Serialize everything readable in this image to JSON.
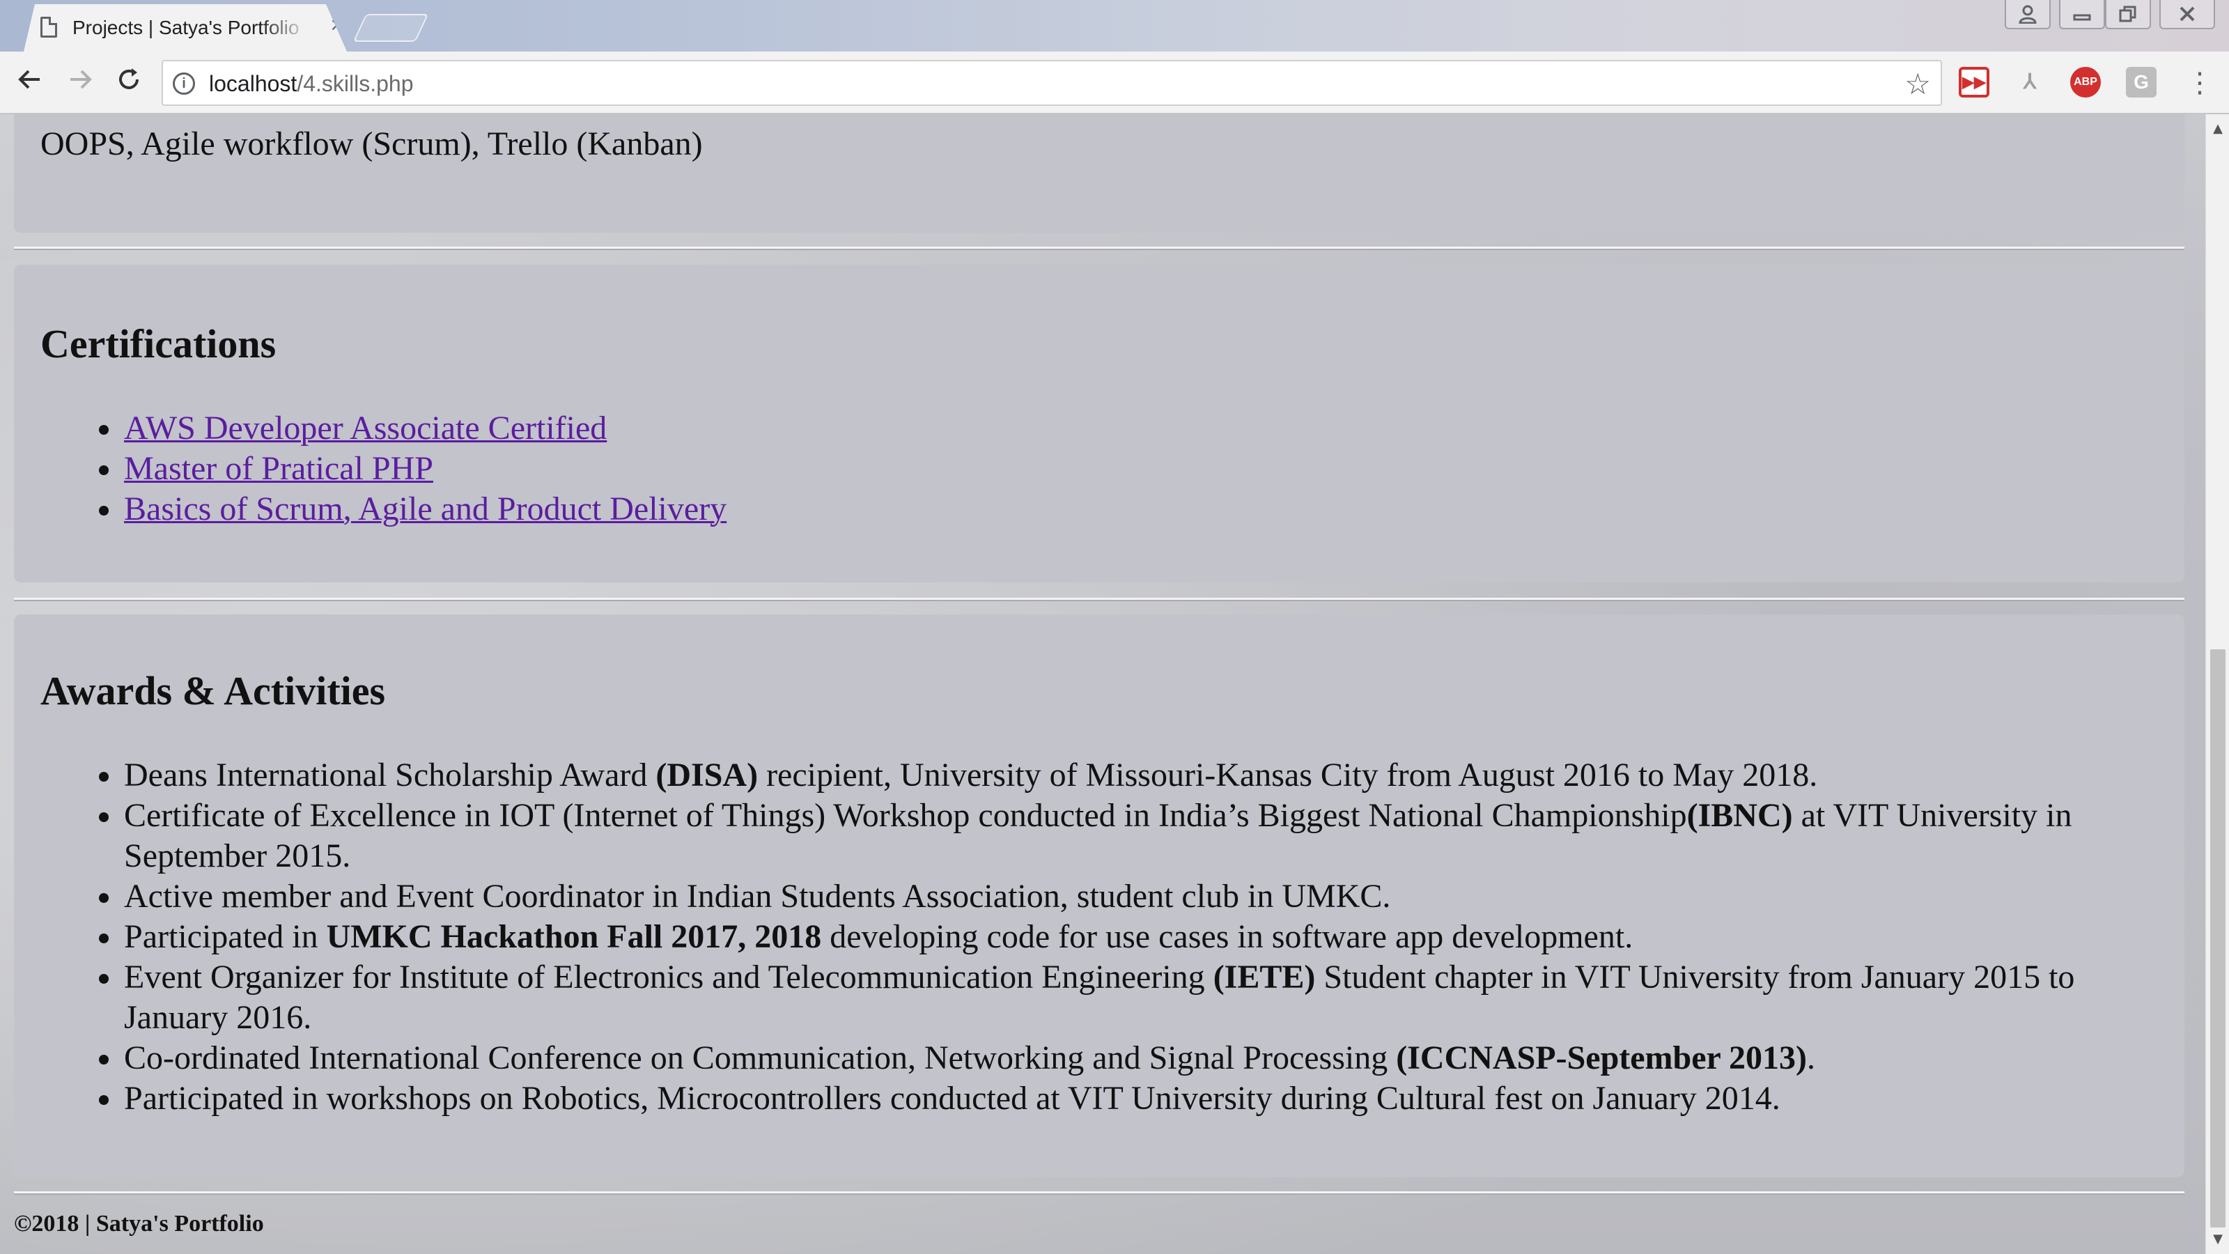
{
  "browser": {
    "tab_title": "Projects | Satya's Portfolio",
    "tab_close": "×",
    "url_host": "localhost",
    "url_path": "/4.skills.php",
    "info_symbol": "i",
    "ext_pdf": "⅄",
    "ext_abp": "ABP",
    "ext_g": "G"
  },
  "page": {
    "skills_tail": "OOPS, Agile workflow (Scrum), Trello (Kanban)",
    "certifications": {
      "title": "Certifications",
      "items": [
        "AWS Developer Associate Certified",
        "Master of Pratical PHP",
        "Basics of Scrum, Agile and Product Delivery"
      ]
    },
    "awards": {
      "title": "Awards & Activities",
      "items": [
        {
          "pre": "Deans International Scholarship Award ",
          "bold": "(DISA)",
          "post": " recipient, University of Missouri-Kansas City from August 2016 to May 2018."
        },
        {
          "pre": "Certificate of Excellence in IOT (Internet of Things) Workshop conducted in India’s Biggest National Championship",
          "bold": "(IBNC)",
          "post": " at VIT University in September 2015."
        },
        {
          "pre": "Active member and Event Coordinator in Indian Students Association, student club in UMKC.",
          "bold": "",
          "post": ""
        },
        {
          "pre": "Participated in ",
          "bold": "UMKC Hackathon Fall 2017, 2018",
          "post": " developing code for use cases in software app development."
        },
        {
          "pre": "Event Organizer for Institute of Electronics and Telecommunication Engineering ",
          "bold": "(IETE)",
          "post": " Student chapter in VIT University from January 2015 to January 2016."
        },
        {
          "pre": "Co-ordinated International Conference on Communication, Networking and Signal Processing ",
          "bold": "(ICCNASP-September 2013)",
          "post": "."
        },
        {
          "pre": "Participated in workshops on Robotics, Microcontrollers conducted at VIT University during Cultural fest on January 2014.",
          "bold": "",
          "post": ""
        }
      ]
    },
    "footer": "©2018 | Satya's Portfolio"
  }
}
